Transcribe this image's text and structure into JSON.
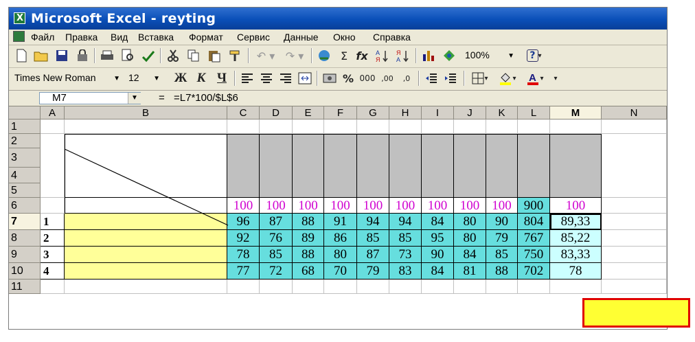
{
  "window": {
    "title": "Microsoft Excel - reyting"
  },
  "menu": {
    "items": [
      "Файл",
      "Правка",
      "Вид",
      "Вставка",
      "Формат",
      "Сервис",
      "Данные",
      "Окно",
      "Справка"
    ]
  },
  "toolbar": {
    "zoom": "100%",
    "font_name": "Times New Roman",
    "font_size": "12",
    "bold": "Ж",
    "italic": "К",
    "underline": "Ч",
    "percent": "%",
    "thousands": "000",
    "inc_decimal": ",00",
    "dec_decimal": ",0",
    "sigma": "Σ",
    "fx": "fx",
    "help": "?"
  },
  "formula_bar": {
    "name_box": "M7",
    "equals": "=",
    "formula": "=L7*100/$L$6"
  },
  "sheet": {
    "columns": [
      "A",
      "B",
      "C",
      "D",
      "E",
      "F",
      "G",
      "H",
      "I",
      "J",
      "K",
      "L",
      "M",
      "N"
    ],
    "selected_column": "M",
    "rows": [
      "1",
      "2",
      "3",
      "4",
      "5",
      "6",
      "7",
      "8",
      "9",
      "10",
      "11"
    ],
    "selected_row": "7",
    "row6": [
      "100",
      "100",
      "100",
      "100",
      "100",
      "100",
      "100",
      "100",
      "100",
      "900",
      "100"
    ],
    "data_rows": [
      {
        "index": "1",
        "values": [
          "96",
          "87",
          "88",
          "91",
          "94",
          "94",
          "84",
          "80",
          "90",
          "804",
          "89,33"
        ]
      },
      {
        "index": "2",
        "values": [
          "92",
          "76",
          "89",
          "86",
          "85",
          "85",
          "95",
          "80",
          "79",
          "767",
          "85,22"
        ]
      },
      {
        "index": "3",
        "values": [
          "78",
          "85",
          "88",
          "80",
          "87",
          "73",
          "90",
          "84",
          "85",
          "750",
          "83,33"
        ]
      },
      {
        "index": "4",
        "values": [
          "77",
          "72",
          "68",
          "70",
          "79",
          "83",
          "84",
          "81",
          "88",
          "702",
          "78"
        ]
      }
    ]
  },
  "colors": {
    "header_gray": "#c0c0c0",
    "name_yellow": "#ffff99",
    "score_teal": "#66dede",
    "result_cyan": "#ccffff",
    "max_pink": "#d000d0",
    "overlay_yellow": "#ffff33",
    "overlay_border": "#e00000"
  }
}
